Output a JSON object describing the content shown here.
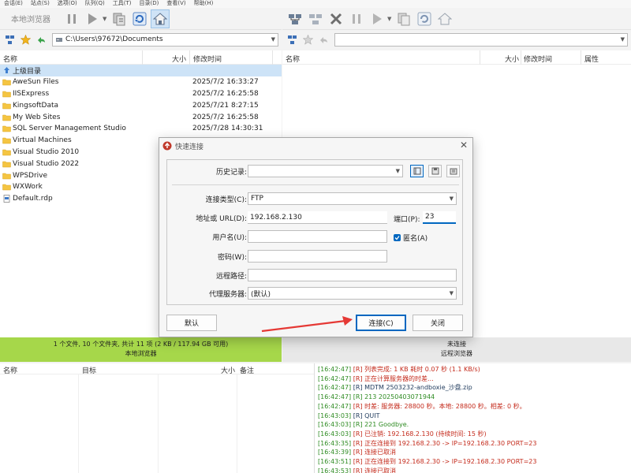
{
  "menu": [
    "会话(E)",
    "站点(S)",
    "选项(O)",
    "队列(Q)",
    "工具(T)",
    "目录(D)",
    "查看(V)",
    "帮助(H)"
  ],
  "left_toolbar": {
    "title": "本地浏览器"
  },
  "left_address": {
    "path": "C:\\Users\\97672\\Documents"
  },
  "right_address": {
    "path": ""
  },
  "left_pane": {
    "columns": {
      "name": "名称",
      "size": "大小",
      "modified": "修改时间"
    },
    "rows": [
      {
        "type": "up",
        "name": "上级目录",
        "date": ""
      },
      {
        "type": "folder",
        "name": "AweSun Files",
        "date": "2025/7/2 16:33:27"
      },
      {
        "type": "folder",
        "name": "IISExpress",
        "date": "2025/7/2 16:25:58"
      },
      {
        "type": "folder",
        "name": "KingsoftData",
        "date": "2025/7/21 8:27:15"
      },
      {
        "type": "folder",
        "name": "My Web Sites",
        "date": "2025/7/2 16:25:58"
      },
      {
        "type": "folder",
        "name": "SQL Server Management Studio",
        "date": "2025/7/28 14:30:31"
      },
      {
        "type": "folder",
        "name": "Virtual Machines",
        "date": ""
      },
      {
        "type": "folder",
        "name": "Visual Studio 2010",
        "date": ""
      },
      {
        "type": "folder",
        "name": "Visual Studio 2022",
        "date": ""
      },
      {
        "type": "folder",
        "name": "WPSDrive",
        "date": ""
      },
      {
        "type": "folder",
        "name": "WXWork",
        "date": ""
      },
      {
        "type": "file",
        "name": "Default.rdp",
        "date": ""
      }
    ]
  },
  "right_pane": {
    "columns": {
      "name": "名称",
      "size": "大小",
      "modified": "修改时间",
      "attr": "属性"
    }
  },
  "status_left": {
    "line1": "1 个文件, 10 个文件夹, 共计 11 项 (2 KB / 117.94 GB 可用)",
    "line2": "本地浏览器"
  },
  "status_right": {
    "line1": "未连接",
    "line2": "远程浏览器"
  },
  "queue": {
    "columns": {
      "name": "名称",
      "target": "目标",
      "size": "大小",
      "note": "备注"
    }
  },
  "log": [
    {
      "ts": "[16:42:47]",
      "text": "[R] 列表完成: 1 KB 耗时 0.07 秒 (1.1 KB/s)",
      "color": "red"
    },
    {
      "ts": "[16:42:47]",
      "text": "[R] 正在计算服务器的时差...",
      "color": "red"
    },
    {
      "ts": "[16:42:47]",
      "text": "[R] MDTM 2503232-andboxie_沙盘.zip",
      "color": "dark"
    },
    {
      "ts": "[16:42:47]",
      "text": "[R] 213 20250403071944",
      "color": "green"
    },
    {
      "ts": "[16:42:47]",
      "text": "[R] 时差: 服务器: 28800 秒。本地: 28800 秒。相差: 0 秒。",
      "color": "red"
    },
    {
      "ts": "[16:43:03]",
      "text": "[R] QUIT",
      "color": "dark"
    },
    {
      "ts": "[16:43:03]",
      "text": "[R] 221 Goodbye.",
      "color": "green"
    },
    {
      "ts": "[16:43:03]",
      "text": "[R] 已注销: 192.168.2.130 (持续时间: 15 秒)",
      "color": "red"
    },
    {
      "ts": "[16:43:35]",
      "text": "[R] 正在连接到 192.168.2.30 -> IP=192.168.2.30 PORT=23",
      "color": "red"
    },
    {
      "ts": "[16:43:39]",
      "text": "[R] 连接已取消",
      "color": "red"
    },
    {
      "ts": "[16:43:51]",
      "text": "[R] 正在连接到 192.168.2.30 -> IP=192.168.2.30 PORT=23",
      "color": "red"
    },
    {
      "ts": "[16:43:53]",
      "text": "[R] 连接已取消",
      "color": "red"
    }
  ],
  "dialog": {
    "title": "快速连接",
    "history_label": "历史记录:",
    "history_value": "",
    "conn_type_label": "连接类型(C):",
    "conn_type_value": "FTP",
    "address_label": "地址或 URL(D):",
    "address_value": "192.168.2.130",
    "port_label": "端口(P):",
    "port_value": "23",
    "user_label": "用户名(U):",
    "user_value": "",
    "anon_label": "匿名(A)",
    "password_label": "密码(W):",
    "password_value": "",
    "remote_path_label": "远程路径:",
    "remote_path_value": "",
    "proxy_label": "代理服务器:",
    "proxy_value": "(默认)",
    "default_button": "默认",
    "connect_button": "连接(C)",
    "close_button": "关闭"
  }
}
